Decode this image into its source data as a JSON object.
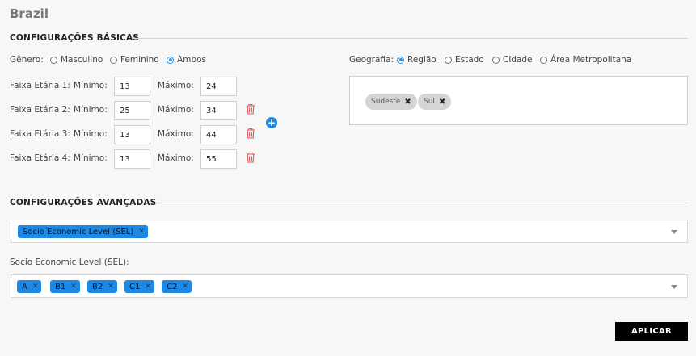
{
  "page": {
    "title": "Brazil"
  },
  "basic": {
    "heading": "CONFIGURAÇÕES BÁSICAS",
    "gender": {
      "label": "Gênero:",
      "options": [
        {
          "label": "Masculino",
          "selected": false
        },
        {
          "label": "Feminino",
          "selected": false
        },
        {
          "label": "Ambos",
          "selected": true
        }
      ]
    },
    "age_ranges": [
      {
        "label": "Faixa Etária 1:",
        "min_label": "Mínimo:",
        "min": "13",
        "max_label": "Máximo:",
        "max": "24",
        "deletable": false
      },
      {
        "label": "Faixa Etária 2:",
        "min_label": "Mínimo:",
        "min": "25",
        "max_label": "Máximo:",
        "max": "34",
        "deletable": true
      },
      {
        "label": "Faixa Etária 3:",
        "min_label": "Mínimo:",
        "min": "13",
        "max_label": "Máximo:",
        "max": "44",
        "deletable": true
      },
      {
        "label": "Faixa Etária 4:",
        "min_label": "Mínimo:",
        "min": "13",
        "max_label": "Máximo:",
        "max": "55",
        "deletable": true
      }
    ],
    "add_icon": "plus-circle-icon",
    "geography": {
      "label": "Geografia:",
      "options": [
        {
          "label": "Região",
          "selected": true
        },
        {
          "label": "Estado",
          "selected": false
        },
        {
          "label": "Cidade",
          "selected": false
        },
        {
          "label": "Área Metropolitana",
          "selected": false
        }
      ],
      "chips": [
        "Sudeste",
        "Sul"
      ]
    }
  },
  "advanced": {
    "heading": "CONFIGURAÇÕES AVANÇADAS",
    "filters": [
      "Socio Economic Level (SEL)"
    ],
    "sel_label": "Socio Economic Level (SEL):",
    "sel_values": [
      "A",
      "B1",
      "B2",
      "C1",
      "C2"
    ]
  },
  "apply_label": "APLICAR",
  "colors": {
    "accent": "#1e88e5",
    "trash": "#e05a5a",
    "chip_gray": "#d5d5d5",
    "button": "#000000"
  }
}
